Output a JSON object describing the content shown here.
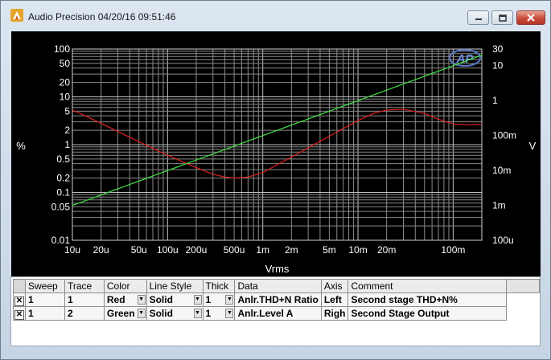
{
  "window": {
    "title": "Audio Precision  04/20/16 09:51:46"
  },
  "chart_data": {
    "type": "line",
    "xlabel": "Vrms",
    "ylabel_left": "%",
    "ylabel_right": "V",
    "x_scale": "log",
    "y_scale": "log",
    "xlim": [
      1e-05,
      0.2
    ],
    "ylim_left": [
      0.01,
      100
    ],
    "ylim_right": [
      0.0001,
      30
    ],
    "grid": true,
    "x_ticks": [
      {
        "value": 1e-05,
        "label": "10u"
      },
      {
        "value": 2e-05,
        "label": "20u"
      },
      {
        "value": 5e-05,
        "label": "50u"
      },
      {
        "value": 0.0001,
        "label": "100u"
      },
      {
        "value": 0.0002,
        "label": "200u"
      },
      {
        "value": 0.0005,
        "label": "500u"
      },
      {
        "value": 0.001,
        "label": "1m"
      },
      {
        "value": 0.002,
        "label": "2m"
      },
      {
        "value": 0.005,
        "label": "5m"
      },
      {
        "value": 0.01,
        "label": "10m"
      },
      {
        "value": 0.02,
        "label": "20m"
      },
      {
        "value": 0.1,
        "label": "100m"
      }
    ],
    "y_ticks_left": [
      {
        "value": 100,
        "label": "100"
      },
      {
        "value": 50,
        "label": "50"
      },
      {
        "value": 20,
        "label": "20"
      },
      {
        "value": 10,
        "label": "10"
      },
      {
        "value": 5,
        "label": "5"
      },
      {
        "value": 2,
        "label": "2"
      },
      {
        "value": 1,
        "label": "1"
      },
      {
        "value": 0.5,
        "label": "0.5"
      },
      {
        "value": 0.2,
        "label": "0.2"
      },
      {
        "value": 0.1,
        "label": "0.1"
      },
      {
        "value": 0.05,
        "label": "0.05"
      },
      {
        "value": 0.01,
        "label": "0.01"
      }
    ],
    "y_ticks_right": [
      {
        "value": 30,
        "label": "30"
      },
      {
        "value": 10,
        "label": "10"
      },
      {
        "value": 1,
        "label": "1"
      },
      {
        "value": 0.1,
        "label": "100m"
      },
      {
        "value": 0.01,
        "label": "10m"
      },
      {
        "value": 0.001,
        "label": "1m"
      },
      {
        "value": 0.0001,
        "label": "100u"
      }
    ],
    "series": [
      {
        "axis": "left",
        "color": "#e02020",
        "x": [
          1e-05,
          2e-05,
          5e-05,
          0.0001,
          0.0002,
          0.0003,
          0.0004,
          0.0005,
          0.0007,
          0.001,
          0.002,
          0.005,
          0.01,
          0.015,
          0.02,
          0.03,
          0.05,
          0.07,
          0.1,
          0.15,
          0.2
        ],
        "values": [
          5.3,
          2.8,
          1.15,
          0.6,
          0.33,
          0.24,
          0.21,
          0.2,
          0.21,
          0.26,
          0.55,
          1.5,
          3.2,
          4.6,
          5.3,
          5.5,
          4.5,
          3.4,
          2.7,
          2.6,
          2.7
        ]
      },
      {
        "axis": "right",
        "color": "#40e040",
        "x": [
          1e-05,
          0.2
        ],
        "values": [
          0.00099,
          20
        ]
      }
    ]
  },
  "trace_table": {
    "headers": [
      "Sweep",
      "Trace",
      "Color",
      "Line Style",
      "Thick",
      "Data",
      "Axis",
      "Comment"
    ],
    "rows": [
      {
        "checked": "✕",
        "sweep": "1",
        "trace": "1",
        "color": "Red",
        "line_style": "Solid",
        "thick": "1",
        "data": "Anlr.THD+N Ratio",
        "axis": "Left",
        "comment": "Second stage THD+N%"
      },
      {
        "checked": "✕",
        "sweep": "1",
        "trace": "2",
        "color": "Green",
        "line_style": "Solid",
        "thick": "1",
        "data": "Anlr.Level A",
        "axis": "Righ",
        "comment": "Second Stage Output"
      }
    ]
  }
}
